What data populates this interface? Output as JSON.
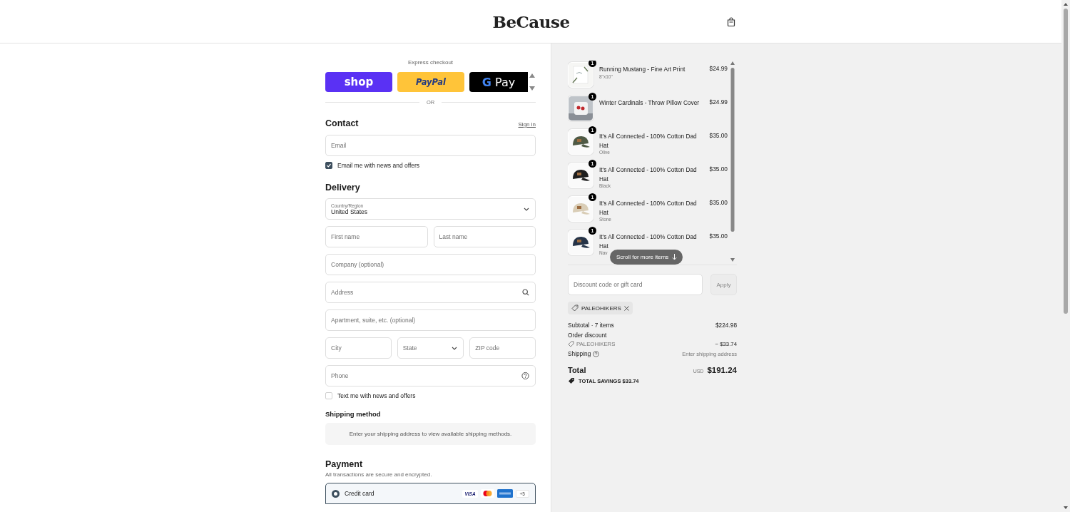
{
  "header": {
    "brand": "BeCause"
  },
  "express": {
    "label": "Express checkout",
    "buttons": [
      {
        "kind": "shop",
        "label": "shop"
      },
      {
        "kind": "paypal",
        "label": "PayPal"
      },
      {
        "kind": "gpay",
        "mark": "G",
        "label": "Pay"
      }
    ],
    "divider": "OR"
  },
  "contact": {
    "title": "Contact",
    "sign_in": "Sign in",
    "email_placeholder": "Email",
    "newsletter": {
      "label": "Email me with news and offers",
      "checked": true
    }
  },
  "delivery": {
    "title": "Delivery",
    "country": {
      "label": "Country/Region",
      "value": "United States"
    },
    "rows": [
      [
        {
          "kind": "text",
          "placeholder": "First name"
        },
        {
          "kind": "text",
          "placeholder": "Last name"
        }
      ],
      [
        {
          "kind": "text",
          "placeholder": "Company (optional)"
        }
      ],
      [
        {
          "kind": "search",
          "placeholder": "Address"
        }
      ],
      [
        {
          "kind": "text",
          "placeholder": "Apartment, suite, etc. (optional)"
        }
      ],
      [
        {
          "kind": "text",
          "placeholder": "City"
        },
        {
          "kind": "select",
          "placeholder": "State"
        },
        {
          "kind": "text",
          "placeholder": "ZIP code"
        }
      ],
      [
        {
          "kind": "help",
          "placeholder": "Phone"
        }
      ]
    ],
    "sms": {
      "label": "Text me with news and offers",
      "checked": false
    }
  },
  "shipping": {
    "title": "Shipping method",
    "note": "Enter your shipping address to view available shipping methods."
  },
  "payment": {
    "title": "Payment",
    "subtitle": "All transactions are secure and encrypted.",
    "methods": [
      {
        "label": "Credit card",
        "selected": true,
        "brands": [
          {
            "kind": "visa",
            "label": "VISA"
          },
          {
            "kind": "mastercard"
          },
          {
            "kind": "amex"
          }
        ],
        "more": "+5"
      }
    ]
  },
  "summary": {
    "items": [
      {
        "title": "Running Mustang - Fine Art Print",
        "variant": "8\"x10\"",
        "price": "$24.99",
        "quantity": "1"
      },
      {
        "title": "Winter Cardinals - Throw Pillow Cover",
        "price": "$24.99",
        "quantity": "1"
      },
      {
        "title": "It's All Connected - 100% Cotton Dad Hat",
        "variant": "Olive",
        "price": "$35.00",
        "quantity": "1"
      },
      {
        "title": "It's All Connected - 100% Cotton Dad Hat",
        "variant": "Black",
        "price": "$35.00",
        "quantity": "1"
      },
      {
        "title": "It's All Connected - 100% Cotton Dad Hat",
        "variant": "Stone",
        "price": "$35.00",
        "quantity": "1"
      },
      {
        "title": "It's All Connected - 100% Cotton Dad Hat",
        "variant": "Nav",
        "price": "$35.00",
        "quantity": "1"
      }
    ],
    "scroll_hint": "Scroll for more items",
    "discount": {
      "placeholder": "Discount code or gift card",
      "apply": "Apply",
      "applied_code": "PALEOHIKERS"
    },
    "subtotal": {
      "label": "Subtotal · 7 items",
      "value": "$224.98"
    },
    "order_discount": {
      "label": "Order discount",
      "code": "PALEOHIKERS",
      "value": "− $33.74"
    },
    "shipping": {
      "label": "Shipping",
      "value": "Enter shipping address"
    },
    "total": {
      "label": "Total",
      "currency": "USD",
      "value": "$191.24"
    },
    "savings": "TOTAL SAVINGS $33.74"
  }
}
